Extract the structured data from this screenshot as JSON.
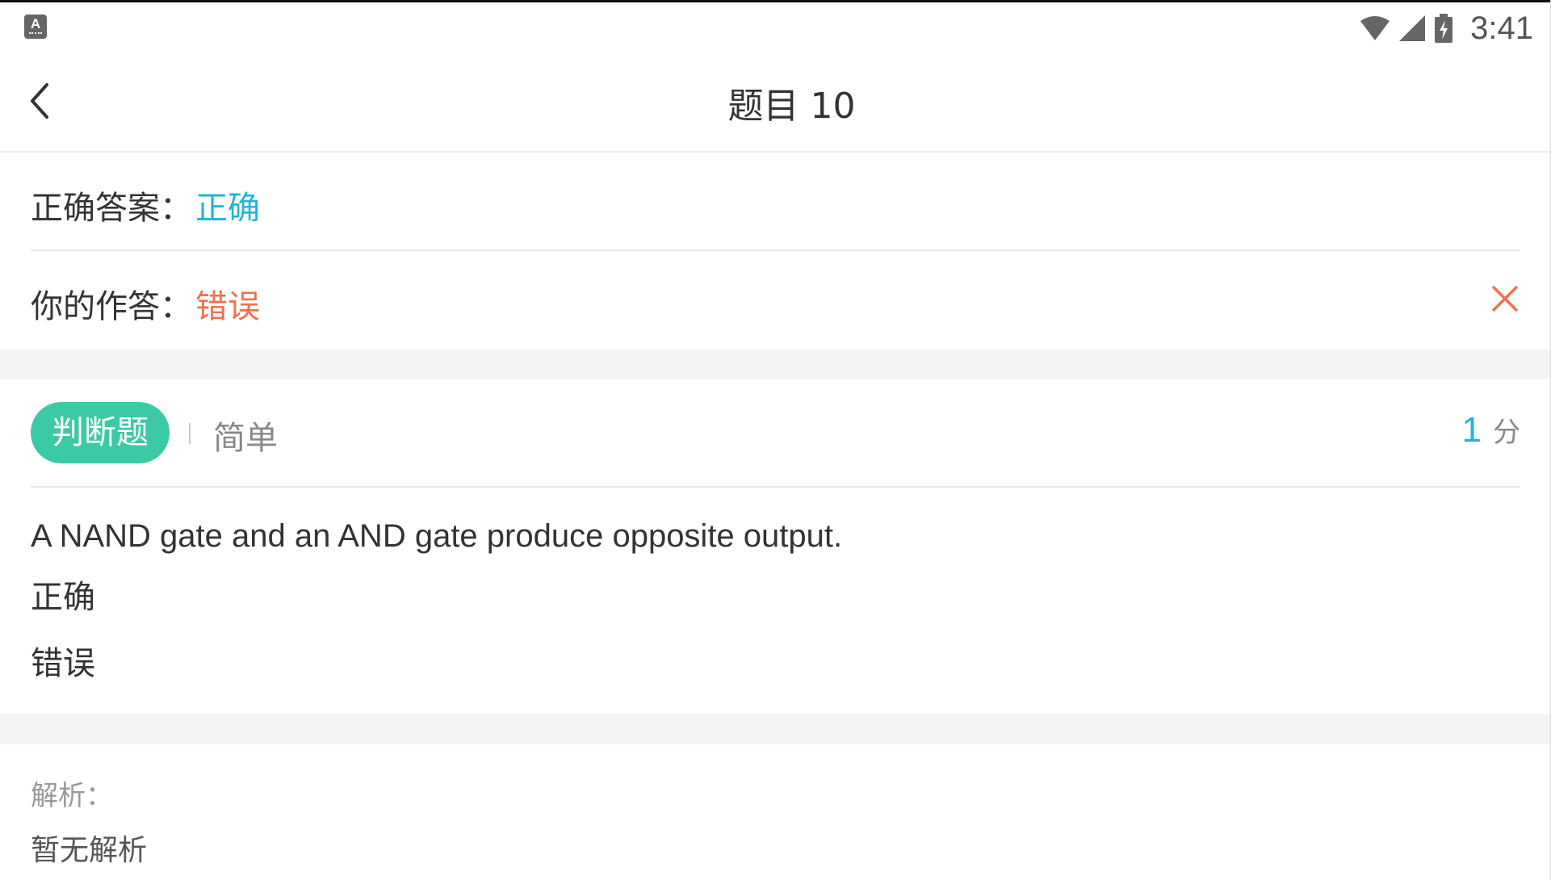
{
  "status_bar": {
    "app_icon_letter": "A",
    "time": "3:41",
    "icons": [
      "wifi-icon",
      "cell-signal-icon",
      "battery-charging-icon"
    ]
  },
  "header": {
    "back_icon": "chevron-left-icon",
    "title": "题目 10"
  },
  "answers": {
    "correct_label": "正确答案：",
    "correct_value": "正确",
    "yours_label": "你的作答：",
    "yours_value": "错误",
    "result_icon": "close-icon",
    "colors": {
      "correct": "#22b4d6",
      "wrong": "#f0704d"
    }
  },
  "question": {
    "type_badge": "判断题",
    "difficulty": "简单",
    "score_value": "1",
    "score_unit": "分",
    "text": "A NAND gate and an AND gate produce opposite output.",
    "options": [
      "正确",
      "错误"
    ],
    "badge_color": "#3cc9a6"
  },
  "analysis": {
    "label": "解析：",
    "text": "暂无解析"
  }
}
